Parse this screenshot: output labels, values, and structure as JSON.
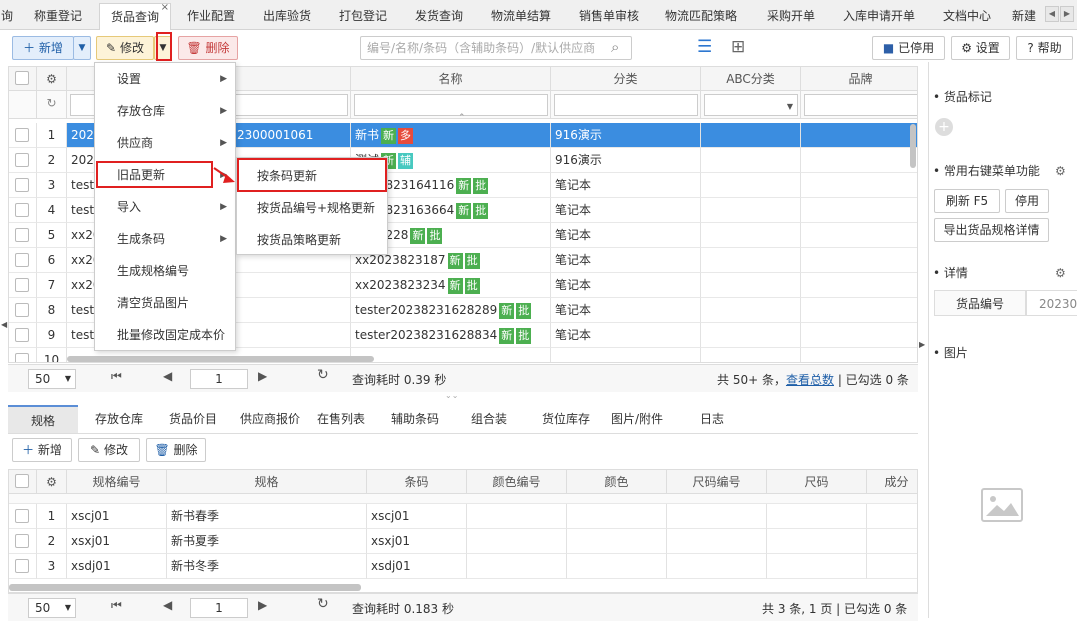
{
  "tabs": [
    {
      "label": "询"
    },
    {
      "label": "称重登记"
    },
    {
      "label": "货品查询"
    },
    {
      "label": "作业配置"
    },
    {
      "label": "出库验货"
    },
    {
      "label": "打包登记"
    },
    {
      "label": "发货查询"
    },
    {
      "label": "物流单结算"
    },
    {
      "label": "销售单审核"
    },
    {
      "label": "物流匹配策略"
    },
    {
      "label": "采购开单"
    },
    {
      "label": "入库申请开单"
    },
    {
      "label": "文档中心"
    },
    {
      "label": "新建"
    }
  ],
  "active_tab_close": "×",
  "toolbar": {
    "add_label": "新增",
    "edit_label": "修改",
    "delete_label": "删除",
    "search_placeholder": "编号/名称/条码（含辅助条码）/默认供应商",
    "disabled_label": "已停用",
    "settings_label": "设置",
    "help_label": "帮助"
  },
  "grid": {
    "headers": {
      "name": "名称",
      "category": "分类",
      "abc": "ABC分类",
      "brand": "品牌"
    },
    "rows": [
      {
        "no": "1",
        "code": "2023",
        "code2": "2300001061",
        "name": "新书",
        "tags": [
          "新",
          "多"
        ],
        "cat": "916演示"
      },
      {
        "no": "2",
        "code": "2023",
        "code2": "",
        "name": "测试",
        "tags": [
          "新",
          "辅"
        ],
        "cat": "916演示"
      },
      {
        "no": "3",
        "code": "teste",
        "code2": "",
        "name": "2023823164116",
        "tags": [
          "新",
          "批"
        ],
        "cat": "笔记本"
      },
      {
        "no": "4",
        "code": "teste",
        "code2": "",
        "name": "2023823163664",
        "tags": [
          "新",
          "批"
        ],
        "cat": "笔记本"
      },
      {
        "no": "5",
        "code": "xx20",
        "code2": "",
        "name": "3823228",
        "tags": [
          "新",
          "批"
        ],
        "cat": "笔记本"
      },
      {
        "no": "6",
        "code": "xx20",
        "code2": "",
        "name": "xx2023823187",
        "tags": [
          "新",
          "批"
        ],
        "cat": "笔记本"
      },
      {
        "no": "7",
        "code": "xx20",
        "code2": "",
        "name": "xx2023823234",
        "tags": [
          "新",
          "批"
        ],
        "cat": "笔记本"
      },
      {
        "no": "8",
        "code": "teste",
        "code2": "",
        "name": "tester20238231628289",
        "tags": [
          "新",
          "批"
        ],
        "cat": "笔记本"
      },
      {
        "no": "9",
        "code": "teste",
        "code2": "",
        "name": "tester20238231628834",
        "tags": [
          "新",
          "批"
        ],
        "cat": "笔记本"
      },
      {
        "no": "10",
        "code": "",
        "code2": "",
        "name": "",
        "tags": [],
        "cat": ""
      }
    ]
  },
  "menu": {
    "items": [
      {
        "label": "设置",
        "arrow": "▶"
      },
      {
        "label": "存放仓库",
        "arrow": "▶"
      },
      {
        "label": "供应商",
        "arrow": "▶"
      },
      {
        "label": "旧品更新",
        "arrow": "▶"
      },
      {
        "label": "导入",
        "arrow": "▶"
      },
      {
        "label": "生成条码",
        "arrow": "▶"
      },
      {
        "label": "生成规格编号",
        "arrow": ""
      },
      {
        "label": "清空货品图片",
        "arrow": ""
      },
      {
        "label": "批量修改固定成本价",
        "arrow": ""
      }
    ],
    "submenu": [
      {
        "label": "按条码更新"
      },
      {
        "label": "按货品编号+规格更新"
      },
      {
        "label": "按货品策略更新"
      }
    ]
  },
  "pager1": {
    "size": "50",
    "page": "1",
    "time": "查询耗时 0.39 秒",
    "total": "共 50+ 条，",
    "total_link": "查看总数",
    "selected": "| 已勾选 0 条"
  },
  "lower_tabs": [
    {
      "label": "规格"
    },
    {
      "label": "存放仓库"
    },
    {
      "label": "货品价目"
    },
    {
      "label": "供应商报价"
    },
    {
      "label": "在售列表"
    },
    {
      "label": "辅助条码"
    },
    {
      "label": "组合装"
    },
    {
      "label": "货位库存"
    },
    {
      "label": "图片/附件"
    },
    {
      "label": "日志"
    }
  ],
  "lower_toolbar": {
    "add_label": "新增",
    "edit_label": "修改",
    "delete_label": "删除"
  },
  "spec_grid": {
    "headers": [
      "规格编号",
      "规格",
      "条码",
      "颜色编号",
      "颜色",
      "尺码编号",
      "尺码",
      "成分"
    ],
    "rows": [
      {
        "no": "1",
        "code": "xscj01",
        "spec": "新书春季",
        "barcode": "xscj01"
      },
      {
        "no": "2",
        "code": "xsxj01",
        "spec": "新书夏季",
        "barcode": "xsxj01"
      },
      {
        "no": "3",
        "code": "xsdj01",
        "spec": "新书冬季",
        "barcode": "xsdj01"
      }
    ]
  },
  "pager2": {
    "size": "50",
    "page": "1",
    "time": "查询耗时 0.183 秒",
    "summary": "共 3 条, 1 页 | 已勾选 0 条"
  },
  "right_panel": {
    "goods_mark": "货品标记",
    "common_menu": "常用右键菜单功能",
    "refresh_btn": "刷新 F5",
    "disable_btn": "停用",
    "export_btn": "导出货品规格详情",
    "details": "详情",
    "goods_code_label": "货品编号",
    "goods_code_value": "20230",
    "picture": "图片"
  },
  "colors": {
    "accent": "#1f5fa8",
    "selected_row": "#3b8de0",
    "red_box": "#e02020"
  }
}
